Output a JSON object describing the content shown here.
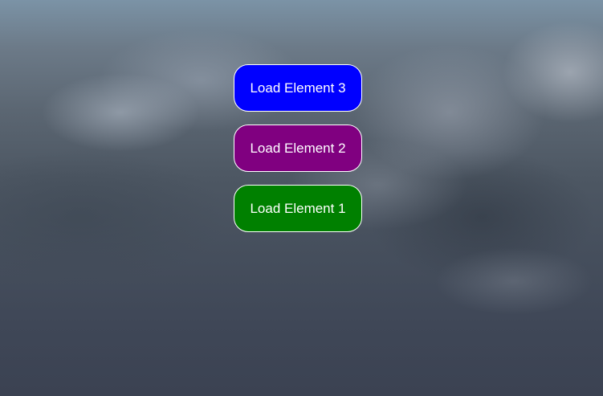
{
  "buttons": [
    {
      "label": "Load Element 3",
      "color": "#0000ff"
    },
    {
      "label": "Load Element 2",
      "color": "#800080"
    },
    {
      "label": "Load Element 1",
      "color": "#008000"
    }
  ]
}
